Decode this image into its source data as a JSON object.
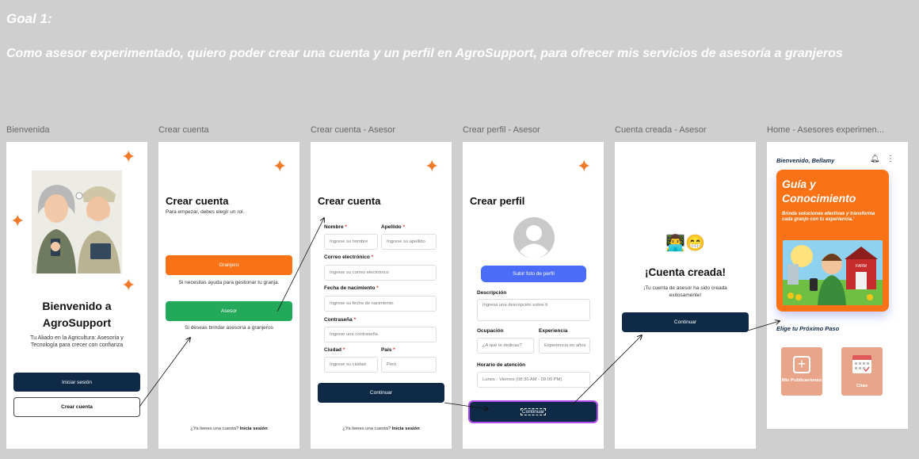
{
  "goal": {
    "title": "Goal 1:",
    "description": "Como asesor experimentado, quiero poder crear una cuenta y un perfil en AgroSupport, para ofrecer mis servicios de asesoría a granjeros"
  },
  "frames": {
    "labels": [
      "Bienvenida",
      "Crear cuenta",
      "Crear cuenta - Asesor",
      "Crear perfil - Asesor",
      "Cuenta creada - Asesor",
      "Home - Asesores experimen..."
    ]
  },
  "bienvenida": {
    "title_line1": "Bienvenido a",
    "title_line2": "AgroSupport",
    "subtitle": "Tu Aliado en la Agricultura: Asesoría y Tecnología para crecer con confianza",
    "login_button": "Iniciar sesión",
    "create_button": "Crear cuenta"
  },
  "crear_cuenta": {
    "title": "Crear cuenta",
    "subtitle": "Para empezar, debes elegir un rol.",
    "granjero_button": "Granjero",
    "granjero_hint": "Si necesitas ayuda para gestionar tu granja.",
    "asesor_button": "Asesor",
    "asesor_hint": "Si deseas brindar asesoría a granjeros",
    "footer_text": "¿Ya tienes una cuenta?",
    "footer_link": "Inicia sesión"
  },
  "crear_cuenta_asesor": {
    "title": "Crear cuenta",
    "nombre_label": "Nombre",
    "nombre_placeholder": "Ingrese su nombre",
    "apellido_label": "Apellido",
    "apellido_placeholder": "Ingrese su apellido",
    "correo_label": "Correo electrónico",
    "correo_placeholder": "Ingrese su correo electrónico",
    "fecha_label": "Fecha de nacimiento",
    "fecha_placeholder": "Ingrese su fecha de nacimiento",
    "contrasena_label": "Contraseña",
    "contrasena_placeholder": "Ingrese una contraseña",
    "ciudad_label": "Ciudad",
    "ciudad_placeholder": "Ingrese su ciudad",
    "pais_label": "País",
    "pais_value": "Perú",
    "continue_button": "Continuar",
    "footer_text": "¿Ya tienes una cuenta?",
    "footer_link": "Inicia sesión",
    "required_mark": "*"
  },
  "crear_perfil": {
    "title": "Crear perfil",
    "upload_button": "Subir foto de perfil",
    "descripcion_label": "Descripción",
    "descripcion_placeholder": "Ingresa una descripción sobre ti",
    "ocupacion_label": "Ocupación",
    "ocupacion_placeholder": "¿A qué te dedicas?",
    "experiencia_label": "Experiencia",
    "experiencia_placeholder": "Experiencia en años",
    "horario_label": "Horario de atención",
    "horario_value": "Lunes - Viernes (08:30 AM - 09:00 PM)",
    "continue_button": "Continuar"
  },
  "cuenta_creada": {
    "emoji": "👨‍💻😁",
    "title": "¡Cuenta creada!",
    "message": "¡Tu cuenta de asesor ha sido creada exitosamente!",
    "continue_button": "Continuar"
  },
  "home": {
    "greeting": "Bienvenido, Bellamy",
    "hero_title_line1": "Guía y",
    "hero_title_line2": "Conocimiento",
    "hero_text": "Brinda soluciones efectivas y transforma cada granjo con tu experiencia.'",
    "barn_label": "FARM",
    "next_step": "Elige tu Próximo Paso",
    "tile1_label": "Mis Publicaciones",
    "tile2_label": "Citas"
  },
  "colors": {
    "orange": "#f97316",
    "green": "#22a95a",
    "navy": "#0f2a47",
    "blue": "#4a6cf7",
    "tile": "#e8a58a",
    "selection": "#b44df0"
  }
}
